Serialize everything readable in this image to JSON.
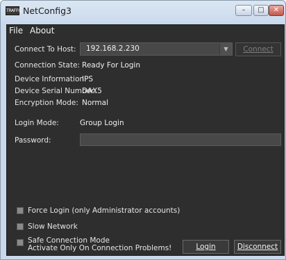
{
  "window": {
    "title": "NetConfig3",
    "app_icon_text": "TRAFFIC",
    "minimize_glyph": "–",
    "maximize_glyph": "□",
    "close_glyph": "✕"
  },
  "menu": {
    "items": [
      {
        "label": "File"
      },
      {
        "label": "About"
      }
    ]
  },
  "connection": {
    "host_label": "Connect To Host:",
    "host_value": "192.168.2.230",
    "connect_button": "Connect",
    "state_label": "Connection State:",
    "state_value": "Ready For Login",
    "device_info_label": "Device Information:",
    "device_info_value": "IPS",
    "serial_label": "Device Serial Number:",
    "serial_value": "DAX5",
    "encryption_label": "Encryption Mode:",
    "encryption_value": "Normal"
  },
  "login": {
    "mode_label": "Login Mode:",
    "mode_value": "Group Login",
    "password_label": "Password:",
    "password_value": "",
    "login_button": "Login",
    "disconnect_button": "Disconnect"
  },
  "options": {
    "force_login": "Force Login (only Administrator accounts)",
    "slow_network": "Slow Network",
    "safe_mode_line1": "Safe Connection Mode",
    "safe_mode_line2": "Activate Only On Connection Problems!"
  }
}
